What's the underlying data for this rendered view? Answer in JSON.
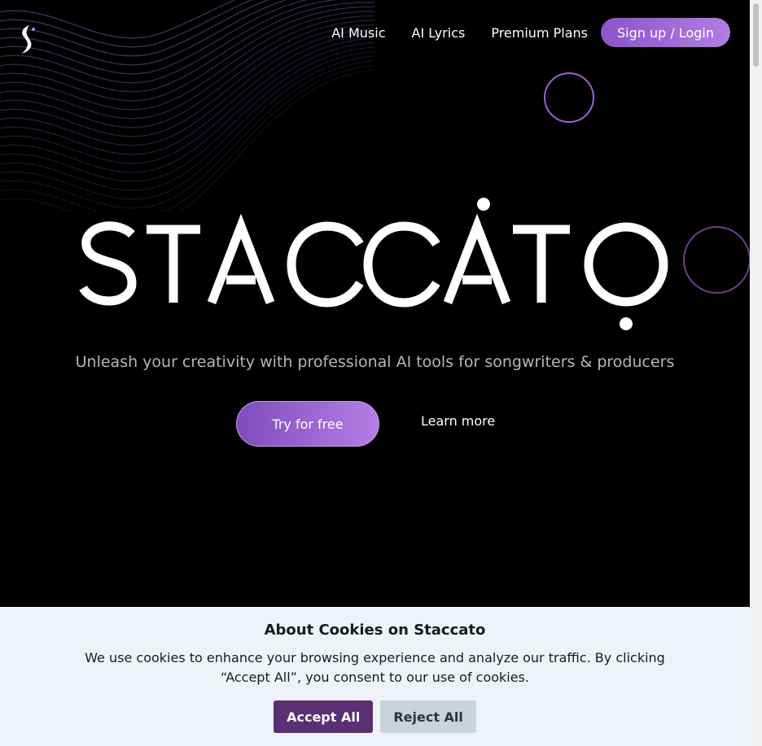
{
  "brand": {
    "logo_icon": "staccato-s-logo",
    "wordmark": "STACCATO",
    "accent": "#9b63d4"
  },
  "nav": {
    "items": [
      {
        "label": "AI Music"
      },
      {
        "label": "AI Lyrics"
      },
      {
        "label": "Premium Plans"
      }
    ],
    "signup_label": "Sign up / Login"
  },
  "hero": {
    "tagline": "Unleash your creativity with professional AI tools for songwriters & producers",
    "try_label": "Try for free",
    "learn_label": "Learn more"
  },
  "cookie_banner": {
    "title": "About Cookies on Staccato",
    "text": "We use cookies to enhance your browsing experience and analyze our traffic. By clicking “Accept All”, you consent to our use of cookies.",
    "accept_label": "Accept All",
    "reject_label": "Reject All",
    "accept_color": "#5a2f73",
    "reject_color": "#c8d3dc"
  }
}
